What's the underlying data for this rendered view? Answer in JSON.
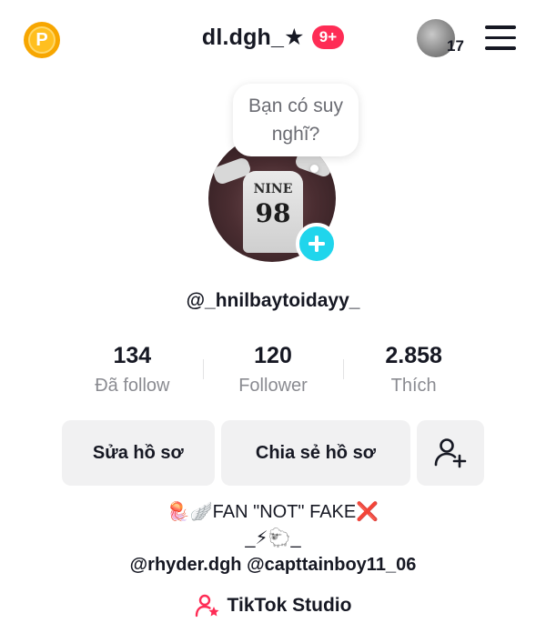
{
  "header": {
    "coin_label": "P",
    "username": "dl.dgh_★",
    "notification_badge": "9+",
    "story_count": "17"
  },
  "avatar_bubble": {
    "text": "Bạn có suy nghĩ?"
  },
  "profile": {
    "handle": "@_hnilbaytoidayy_",
    "avatar_shirt_text": "NINE",
    "avatar_shirt_number": "98"
  },
  "stats": [
    {
      "value": "134",
      "label": "Đã follow"
    },
    {
      "value": "120",
      "label": "Follower"
    },
    {
      "value": "2.858",
      "label": "Thích"
    }
  ],
  "buttons": {
    "edit_profile": "Sửa hồ sơ",
    "share_profile": "Chia sẻ hồ sơ"
  },
  "bio": {
    "line1": "🪼🪽FAN \"NOT\" FAKE❌",
    "line2": "_⚡🐑_",
    "line3": "@rhyder.dgh @capttainboy11_06"
  },
  "studio": {
    "label": "TikTok Studio"
  },
  "colors": {
    "accent_pink": "#fe2c55",
    "accent_cyan": "#20d5ec",
    "coin_gold": "#f7a600"
  }
}
